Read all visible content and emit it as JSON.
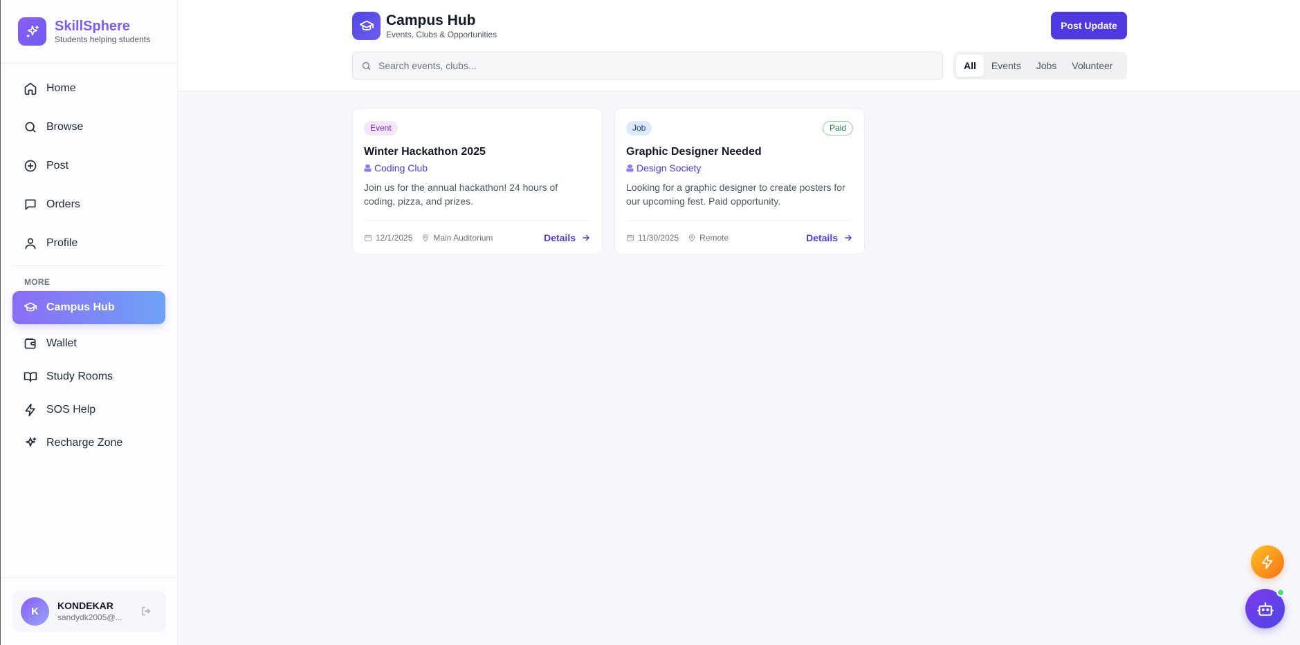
{
  "brand": {
    "name": "SkillSphere",
    "tagline": "Students helping students",
    "icon": "sparkles-icon"
  },
  "sidebar": {
    "main_items": [
      {
        "label": "Home",
        "icon": "home-icon"
      },
      {
        "label": "Browse",
        "icon": "search-icon"
      },
      {
        "label": "Post",
        "icon": "plus-circle-icon"
      },
      {
        "label": "Orders",
        "icon": "message-square-icon"
      },
      {
        "label": "Profile",
        "icon": "user-icon"
      }
    ],
    "section_label": "MORE",
    "more_items": [
      {
        "label": "Campus Hub",
        "icon": "graduation-cap-icon",
        "active": true
      },
      {
        "label": "Wallet",
        "icon": "wallet-icon"
      },
      {
        "label": "Study Rooms",
        "icon": "book-open-icon"
      },
      {
        "label": "SOS Help",
        "icon": "zap-icon"
      },
      {
        "label": "Recharge Zone",
        "icon": "sparkles-icon"
      }
    ]
  },
  "user": {
    "initial": "K",
    "name": "KONDEKAR",
    "email": "sandydk2005@..."
  },
  "header": {
    "title": "Campus Hub",
    "subtitle": "Events, Clubs & Opportunities",
    "post_button": "Post Update",
    "search_placeholder": "Search events, clubs...",
    "search_value": "",
    "filters": [
      {
        "label": "All",
        "active": true
      },
      {
        "label": "Events"
      },
      {
        "label": "Jobs"
      },
      {
        "label": "Volunteer"
      }
    ]
  },
  "cards": [
    {
      "tag": "Event",
      "badge": "",
      "title": "Winter Hackathon 2025",
      "org": "Coding Club",
      "description": "Join us for the annual hackathon! 24 hours of coding, pizza, and prizes.",
      "date": "12/1/2025",
      "location": "Main Auditorium",
      "action": "Details"
    },
    {
      "tag": "Job",
      "badge": "Paid",
      "title": "Graphic Designer Needed",
      "org": "Design Society",
      "description": "Looking for a graphic designer to create posters for our upcoming fest. Paid opportunity.",
      "date": "11/30/2025",
      "location": "Remote",
      "action": "Details"
    }
  ],
  "colors": {
    "primary": "#4f39e0",
    "brand": "#7c5cf5",
    "active_gradient_start": "#8b6cf6",
    "active_gradient_end": "#6ea3f7",
    "online": "#4ade80"
  }
}
